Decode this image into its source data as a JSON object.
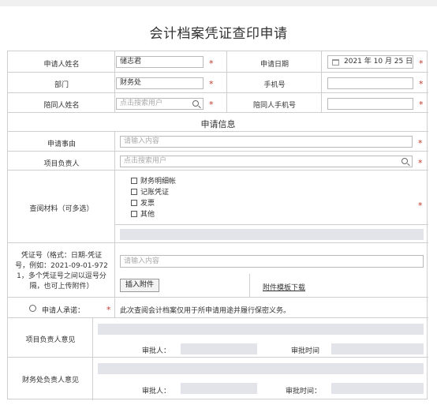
{
  "title": "会计档案凭证查印申请",
  "applicant": {
    "label": "申请人姓名",
    "value": "储志君"
  },
  "apply_date": {
    "label": "申请日期",
    "value": "2021 年 10 月 25 日"
  },
  "department": {
    "label": "部门",
    "value": "财务处"
  },
  "mobile": {
    "label": "手机号",
    "value": ""
  },
  "companion": {
    "label": "陪同人姓名",
    "placeholder": "点击搜索用户"
  },
  "companion_mobile": {
    "label": "陪同人手机号",
    "value": ""
  },
  "section_title": "申请信息",
  "reason": {
    "label": "申请事由",
    "placeholder": "请输入内容"
  },
  "project_lead": {
    "label": "项目负责人",
    "placeholder": "点击搜索用户"
  },
  "materials": {
    "label": "查阅材料（可多选）",
    "options": [
      "财务明细帐",
      "记账凭证",
      "发票",
      "其他"
    ]
  },
  "voucher": {
    "label_lines": [
      "凭证号（格式：日期-凭证",
      "号，例如：2021-09-01-972",
      "1，多个凭证号之间以逗号分",
      "隔，也可上传附件）"
    ],
    "placeholder": "请输入内容",
    "insert_button": "插入附件",
    "template_link": "附件模板下载"
  },
  "commitment": {
    "label": "申请人承诺：",
    "text": "此次查阅会计档案仅用于所申请用途并履行保密义务。"
  },
  "project_opinion": {
    "label": "项目负责人意见",
    "approver": "审批人：",
    "time": "审批时间"
  },
  "finance_opinion": {
    "label": "财务处负责人意见",
    "approver": "审批人：",
    "time": "审批时间："
  },
  "required_mark": "*",
  "colors": {
    "required": "#c0392b",
    "border": "#cfcfcf",
    "approval_fill": "#e2e4e9"
  }
}
